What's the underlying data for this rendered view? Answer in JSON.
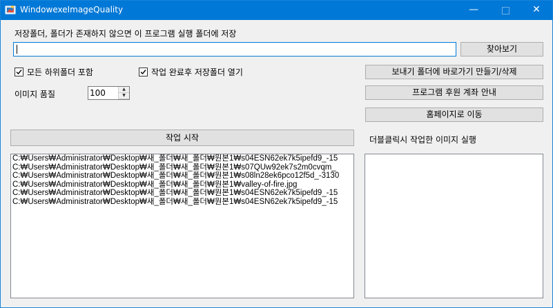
{
  "window": {
    "title": "WindowexeImageQuality",
    "minimize_glyph": "—",
    "close_glyph": "✕"
  },
  "save_folder": {
    "label": "저장폴더, 폴더가 존재하지 않으면 이 프로그램 실행 폴더에 저장",
    "value": "",
    "browse_label": "찾아보기"
  },
  "options": {
    "include_subfolders_label": "모든 하위폴더 포함",
    "include_subfolders_checked": true,
    "open_after_label": "작업 완료후 저장폴더 열기",
    "open_after_checked": true,
    "quality_label": "이미지 품질",
    "quality_value": "100"
  },
  "side_buttons": {
    "shortcut_label": "보내기 폴더에 바로가기 만들기/삭제",
    "donate_label": "프로그램 후원 계좌 안내",
    "homepage_label": "홈페이지로 이동"
  },
  "start_button_label": "작업 시작",
  "result_hint": "더블클릭시 작업한 이미지 실행",
  "file_list": [
    "C:₩Users₩Administrator₩Desktop₩새_폴더₩새_폴더₩원본1₩s04ESN62ek7k5ipefd9_-15",
    "C:₩Users₩Administrator₩Desktop₩새_폴더₩새_폴더₩원본1₩s07QUw92ek7s2m0cvqm_",
    "C:₩Users₩Administrator₩Desktop₩새_폴더₩새_폴더₩원본1₩s08ln28ek6pco12f5d_-3130",
    "C:₩Users₩Administrator₩Desktop₩새_폴더₩새_폴더₩원본1₩valley-of-fire.jpg",
    "C:₩Users₩Administrator₩Desktop₩새_폴더₩새_폴더₩원본1₩s04ESN62ek7k5ipefd9_-15",
    "C:₩Users₩Administrator₩Desktop₩새_폴더₩새_폴더₩원본1₩s04ESN62ek7k5ipefd9_-15"
  ],
  "result_list": []
}
